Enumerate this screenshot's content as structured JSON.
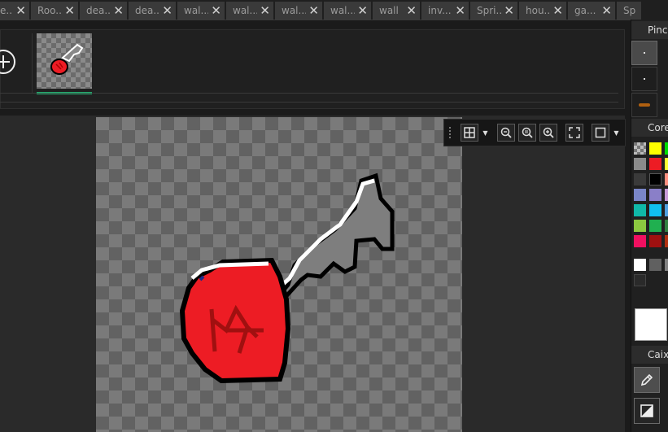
{
  "tabs": [
    {
      "label": "e..."
    },
    {
      "label": "Roo..."
    },
    {
      "label": "dea..."
    },
    {
      "label": "dea..."
    },
    {
      "label": "wal..."
    },
    {
      "label": "wal..."
    },
    {
      "label": "wal..."
    },
    {
      "label": "wal..."
    },
    {
      "label": "wall"
    },
    {
      "label": "inv..."
    },
    {
      "label": "Spri..."
    },
    {
      "label": "hou..."
    },
    {
      "label": "ga..."
    },
    {
      "label": "Sp"
    }
  ],
  "panels": {
    "brushes_title": "Pince",
    "colors_title": "Core",
    "toolbox_title": "Caixa"
  },
  "colors": {
    "accent_active_frame": "#22b573",
    "primary_color": "#ffffff",
    "palette": [
      "#ffff00",
      "#00dd00",
      "#8a8a8a",
      "#ed1c24",
      "#ffff33",
      "#3a3a3a",
      "#000000",
      "#ff9080",
      "#7a86c8",
      "#8a7fc8",
      "#c89ad8",
      "#10b8a8",
      "#10c0f0",
      "#50a0e0",
      "#8cc840",
      "#20b050",
      "#308040",
      "#a01010",
      "#b03010",
      "#f01060",
      "#d0509a",
      "#ffffff",
      "#606060",
      "#808080",
      "#2a2a2a"
    ]
  },
  "toolbar": {
    "items": [
      "grid-icon",
      "zoom-out-icon",
      "zoom-reset-icon",
      "zoom-in-icon",
      "fullscreen-icon",
      "background-icon"
    ]
  }
}
